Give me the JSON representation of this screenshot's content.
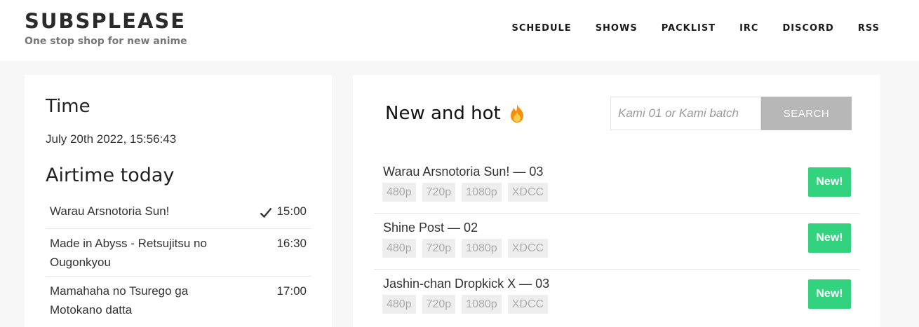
{
  "brand": {
    "title": "SUBSPLEASE",
    "tagline": "One stop shop for new anime"
  },
  "nav": [
    "SCHEDULE",
    "SHOWS",
    "PACKLIST",
    "IRC",
    "DISCORD",
    "RSS"
  ],
  "time": {
    "heading": "Time",
    "value": "July 20th 2022, 15:56:43"
  },
  "airtime": {
    "heading": "Airtime today",
    "items": [
      {
        "name": "Warau Arsnotoria Sun!",
        "time": "15:00",
        "aired": true
      },
      {
        "name": "Made in Abyss - Retsujitsu no Ougonkyou",
        "time": "16:30",
        "aired": false
      },
      {
        "name": "Mamahaha no Tsurego ga Motokano datta",
        "time": "17:00",
        "aired": false
      }
    ]
  },
  "newhot": {
    "heading": "New and hot",
    "icon": "fire-icon",
    "search": {
      "placeholder": "Kami 01 or Kami batch",
      "value": "",
      "button": "SEARCH"
    },
    "releases": [
      {
        "title": "Warau Arsnotoria Sun! — 03",
        "qualities": [
          "480p",
          "720p",
          "1080p",
          "XDCC"
        ],
        "badge": "New!"
      },
      {
        "title": "Shine Post — 02",
        "qualities": [
          "480p",
          "720p",
          "1080p",
          "XDCC"
        ],
        "badge": "New!"
      },
      {
        "title": "Jashin-chan Dropkick X — 03",
        "qualities": [
          "480p",
          "720p",
          "1080p",
          "XDCC"
        ],
        "badge": "New!"
      }
    ]
  },
  "colors": {
    "badge": "#32d27e",
    "search_button": "#b7b7b7",
    "background": "#f7f7f7"
  }
}
